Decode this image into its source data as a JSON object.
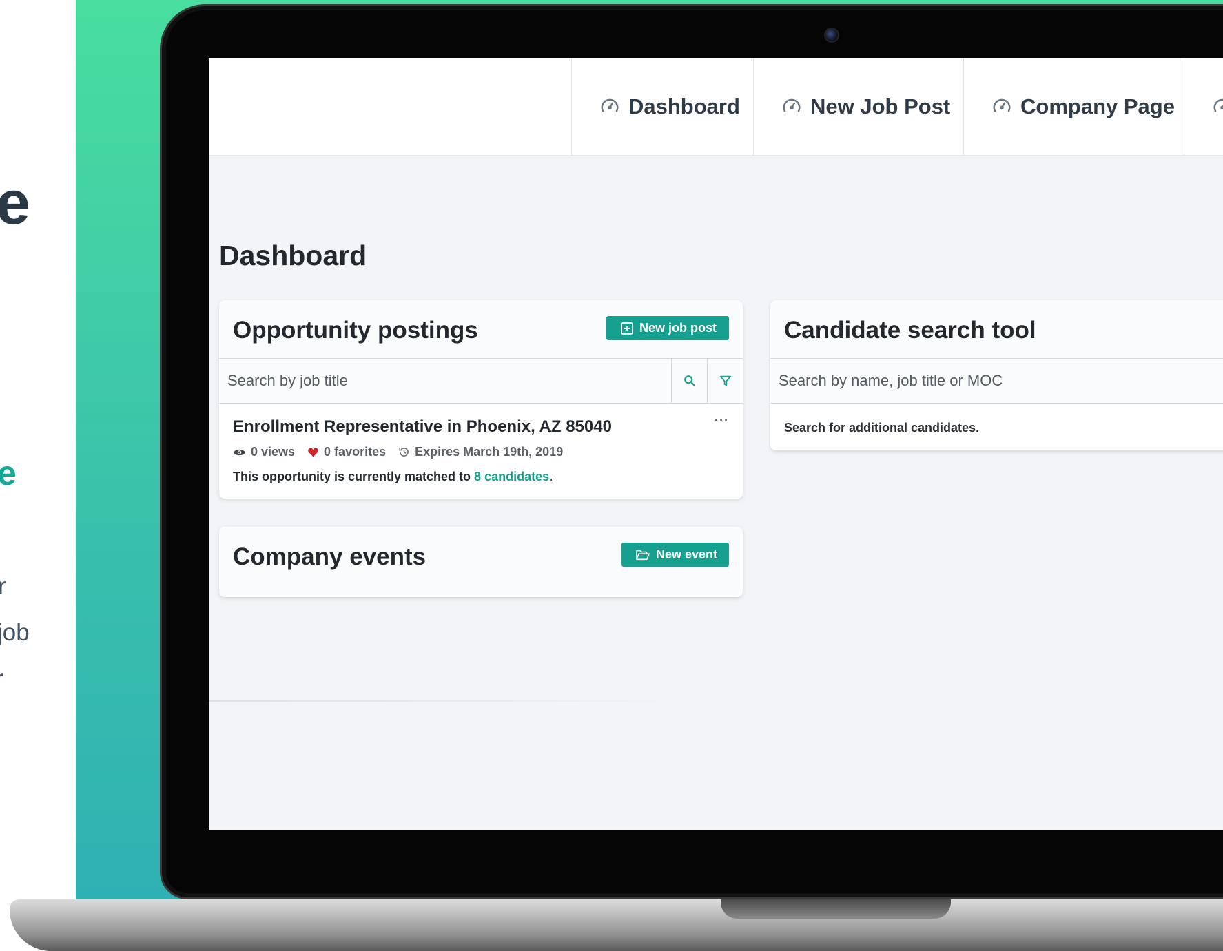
{
  "promo": {
    "headline_fragment": "e",
    "accent_fragment": "e",
    "paragraph_lines": [
      "r",
      "job",
      "ur"
    ]
  },
  "nav": {
    "items": [
      {
        "label": "Dashboard",
        "icon": "speedometer-icon"
      },
      {
        "label": "New Job Post",
        "icon": "speedometer-icon"
      },
      {
        "label": "Company Page",
        "icon": "speedometer-icon"
      }
    ]
  },
  "page": {
    "title": "Dashboard"
  },
  "opportunities": {
    "title": "Opportunity postings",
    "new_button": "New job post",
    "search_placeholder": "Search by job title",
    "job": {
      "title": "Enrollment Representative in Phoenix, AZ 85040",
      "views": "0 views",
      "favorites": "0 favorites",
      "expires": "Expires March 19th, 2019",
      "match_prefix": "This opportunity is currently matched to ",
      "match_link": "8 candidates",
      "match_suffix": "."
    }
  },
  "events": {
    "title": "Company events",
    "new_button": "New event"
  },
  "candidates": {
    "title": "Candidate search tool",
    "search_placeholder": "Search by name, job title or MOC",
    "note": "Search for additional candidates."
  },
  "colors": {
    "accent": "#16a08f",
    "gradient_top": "#49de9f",
    "gradient_bottom": "#2fb0b3",
    "heart": "#d0202a"
  }
}
